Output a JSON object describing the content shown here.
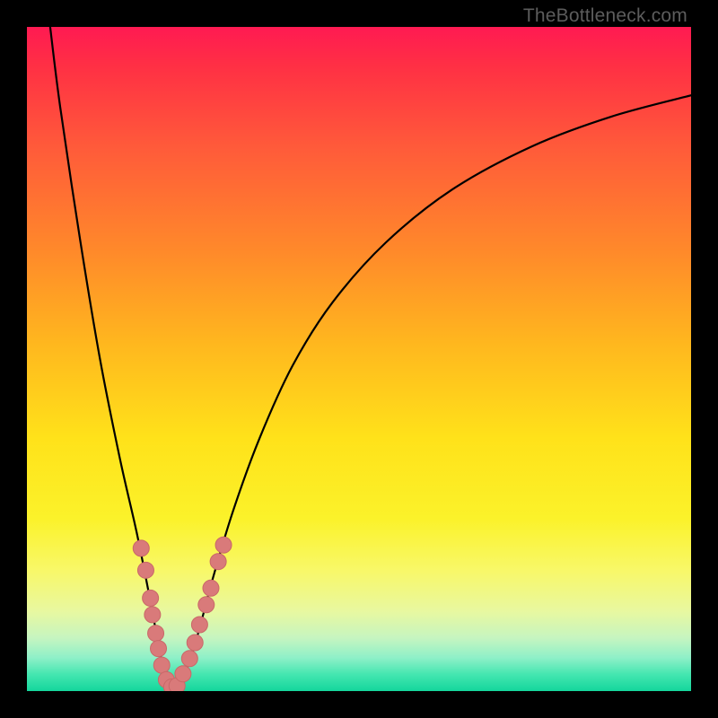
{
  "watermark": "TheBottleneck.com",
  "colors": {
    "frame": "#000000",
    "gradient_top": "#ff1a52",
    "gradient_mid": "#ffe21a",
    "gradient_bottom": "#14d69c",
    "curve_stroke": "#000000",
    "marker_fill": "#d97a7a",
    "marker_stroke": "#c96868"
  },
  "chart_data": {
    "type": "line",
    "title": "",
    "xlabel": "",
    "ylabel": "",
    "xlim": [
      0,
      100
    ],
    "ylim": [
      0,
      100
    ],
    "grid": false,
    "legend": false,
    "notes": "V-shaped bottleneck curve on a red-to-green vertical gradient. Left branch descends steeply from top-left edge to a minimum near x≈22, right branch rises with decreasing slope toward the upper-right. Y-values are estimated from pixel positions (0 at bottom, 100 at top).",
    "series": [
      {
        "name": "bottleneck-curve",
        "x": [
          3.5,
          5,
          8,
          11,
          14,
          16.5,
          18.5,
          20,
          21,
          22,
          23,
          24.5,
          26,
          28,
          31,
          35,
          40,
          46,
          54,
          64,
          76,
          88,
          100
        ],
        "y": [
          100,
          88,
          68,
          50,
          35,
          24,
          14,
          6,
          1.8,
          0.4,
          1.5,
          4.5,
          9.5,
          17,
          27,
          38,
          49,
          58.5,
          67.5,
          75.5,
          82,
          86.5,
          89.7
        ]
      }
    ],
    "markers": {
      "name": "highlighted-points",
      "note": "Salmon dot markers clustered near the curve minimum on both branches.",
      "points": [
        {
          "x": 17.2,
          "y": 21.5
        },
        {
          "x": 17.9,
          "y": 18.2
        },
        {
          "x": 18.6,
          "y": 14.0
        },
        {
          "x": 18.9,
          "y": 11.5
        },
        {
          "x": 19.4,
          "y": 8.7
        },
        {
          "x": 19.8,
          "y": 6.4
        },
        {
          "x": 20.3,
          "y": 3.9
        },
        {
          "x": 21.0,
          "y": 1.7
        },
        {
          "x": 21.8,
          "y": 0.6
        },
        {
          "x": 22.6,
          "y": 0.8
        },
        {
          "x": 23.5,
          "y": 2.6
        },
        {
          "x": 24.5,
          "y": 4.9
        },
        {
          "x": 25.3,
          "y": 7.3
        },
        {
          "x": 26.0,
          "y": 10.0
        },
        {
          "x": 27.0,
          "y": 13.0
        },
        {
          "x": 27.7,
          "y": 15.5
        },
        {
          "x": 28.8,
          "y": 19.5
        },
        {
          "x": 29.6,
          "y": 22.0
        }
      ]
    }
  }
}
